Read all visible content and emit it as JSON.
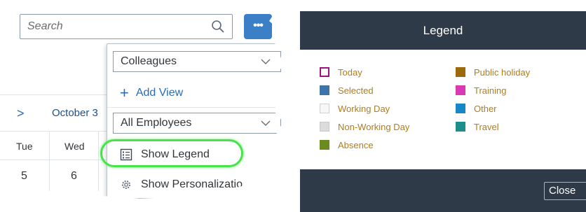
{
  "toolbar": {
    "search_placeholder": "Search",
    "more_label": "•••"
  },
  "calendar": {
    "month_label": "October 3",
    "day_names": [
      "Tue",
      "Wed"
    ],
    "day_numbers": [
      "5",
      "6"
    ]
  },
  "menu": {
    "view_select": "Colleagues",
    "add_view_label": "Add View",
    "employee_select": "All Employees",
    "show_legend_label": "Show Legend",
    "show_personalization_label": "Show Personalizatio"
  },
  "legend": {
    "title": "Legend",
    "close_label": "Close",
    "items_left": [
      {
        "label": "Today",
        "color": "#ffffff",
        "border": "#a3137a"
      },
      {
        "label": "Selected",
        "color": "#3e75a8",
        "border": "#3e75a8"
      },
      {
        "label": "Working Day",
        "color": "#f7f7f7",
        "border": "#d0d0d0"
      },
      {
        "label": "Non-Working Day",
        "color": "#dcdcdc",
        "border": "#c8c8c8"
      },
      {
        "label": "Absence",
        "color": "#6a8c1e",
        "border": "#6a8c1e"
      }
    ],
    "items_right": [
      {
        "label": "Public holiday",
        "color": "#9c6a0c",
        "border": "#9c6a0c"
      },
      {
        "label": "Training",
        "color": "#d83ab3",
        "border": "#d83ab3"
      },
      {
        "label": "Other",
        "color": "#1887c8",
        "border": "#1887c8"
      },
      {
        "label": "Travel",
        "color": "#1c8f8a",
        "border": "#1c8f8a"
      }
    ]
  },
  "colors": {
    "accent": "#3b7fc7",
    "highlight": "#48e34a",
    "dialog_dark": "#2e3a47",
    "legend_text": "#b07d1b"
  }
}
